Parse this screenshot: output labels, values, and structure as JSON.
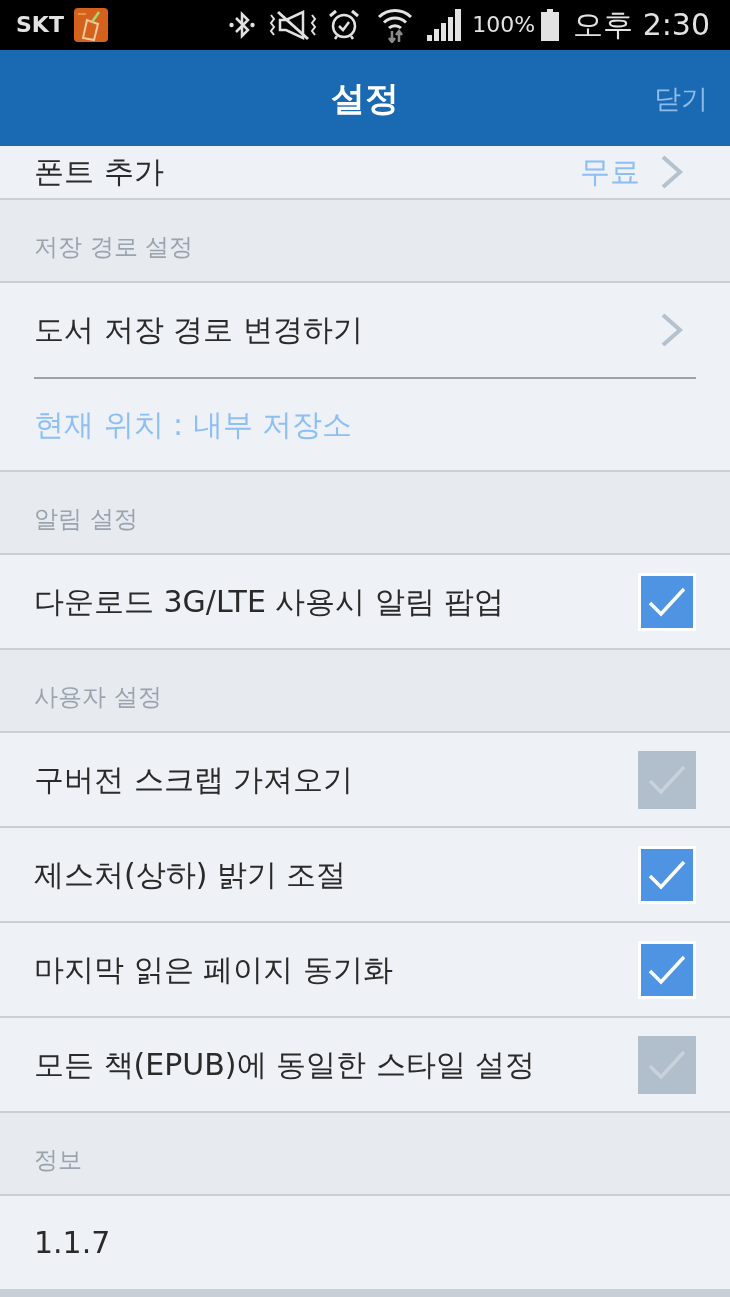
{
  "status_bar": {
    "carrier": "SKT",
    "battery": "100%",
    "time": "오후 2:30"
  },
  "header": {
    "title": "설정",
    "close": "닫기"
  },
  "top_row": {
    "label": "폰트 추가",
    "value": "무료"
  },
  "sections": [
    {
      "title": "저장 경로 설정",
      "rows": [
        {
          "kind": "link",
          "label": "도서 저장 경로 변경하기"
        },
        {
          "kind": "note",
          "label": "현재 위치 : 내부 저장소"
        }
      ]
    },
    {
      "title": "알림 설정",
      "rows": [
        {
          "kind": "checkbox",
          "label": "다운로드 3G/LTE 사용시 알림 팝업",
          "checked": true,
          "disabled": false
        }
      ]
    },
    {
      "title": "사용자 설정",
      "rows": [
        {
          "kind": "checkbox",
          "label": "구버전 스크랩 가져오기",
          "checked": true,
          "disabled": true
        },
        {
          "kind": "checkbox",
          "label": "제스처(상하) 밝기 조절",
          "checked": true,
          "disabled": false
        },
        {
          "kind": "checkbox",
          "label": "마지막 읽은 페이지 동기화",
          "checked": true,
          "disabled": false
        },
        {
          "kind": "checkbox",
          "label": "모든 책(EPUB)에 동일한 스타일 설정",
          "checked": true,
          "disabled": true
        }
      ]
    },
    {
      "title": "정보",
      "rows": [
        {
          "kind": "text",
          "label": "1.1.7"
        }
      ]
    }
  ]
}
